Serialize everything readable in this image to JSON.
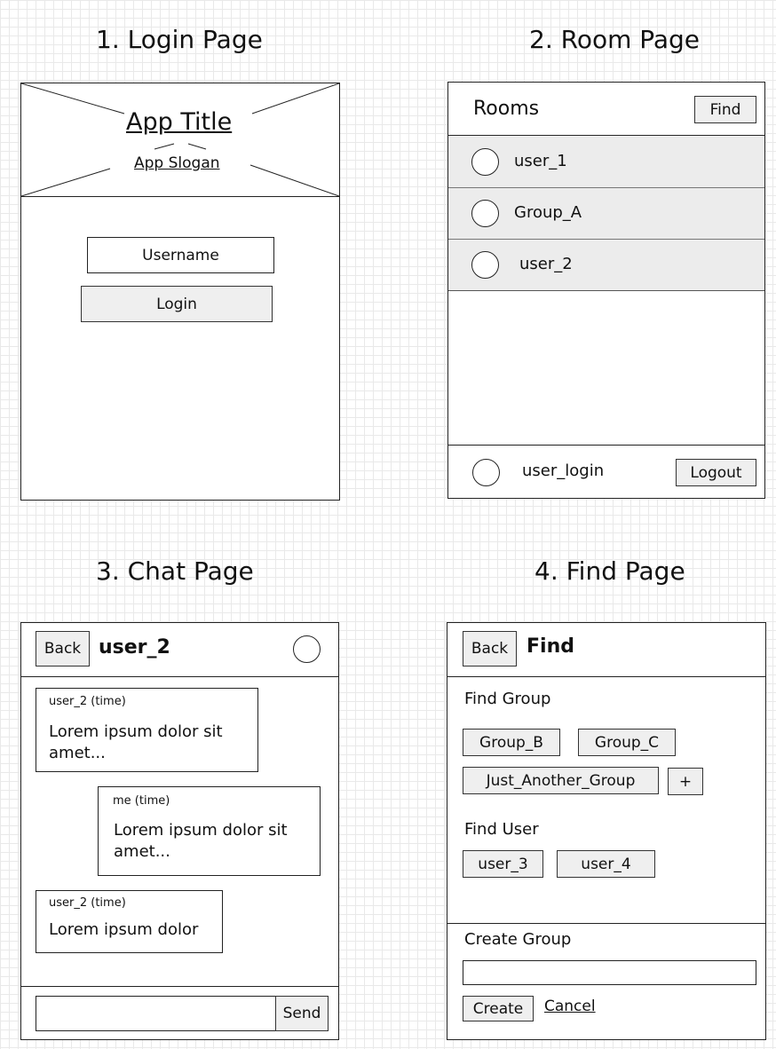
{
  "login_page": {
    "heading": "1. Login Page",
    "app_title": "App Title",
    "app_slogan": "App Slogan",
    "username_placeholder": "Username",
    "login_label": "Login"
  },
  "room_page": {
    "heading": "2. Room Page",
    "rooms_title": "Rooms",
    "find_label": "Find",
    "rooms": [
      {
        "name": "user_1"
      },
      {
        "name": "Group_A"
      },
      {
        "name": "user_2"
      }
    ],
    "current_user": "user_login",
    "logout_label": "Logout"
  },
  "chat_page": {
    "heading": "3. Chat Page",
    "back_label": "Back",
    "chat_title": "user_2",
    "messages": [
      {
        "meta": "user_2 (time)",
        "text": "Lorem ipsum dolor sit amet..."
      },
      {
        "meta": "me (time)",
        "text": "Lorem ipsum dolor sit amet..."
      },
      {
        "meta": "user_2 (time)",
        "text": "Lorem ipsum dolor"
      }
    ],
    "send_label": "Send"
  },
  "find_page": {
    "heading": "4. Find Page",
    "back_label": "Back",
    "title": "Find",
    "find_group_label": "Find Group",
    "groups": [
      "Group_B",
      "Group_C",
      "Just_Another_Group"
    ],
    "add_label": "+",
    "find_user_label": "Find User",
    "users": [
      "user_3",
      "user_4"
    ],
    "create_group_label": "Create Group",
    "create_label": "Create",
    "cancel_label": "Cancel"
  }
}
